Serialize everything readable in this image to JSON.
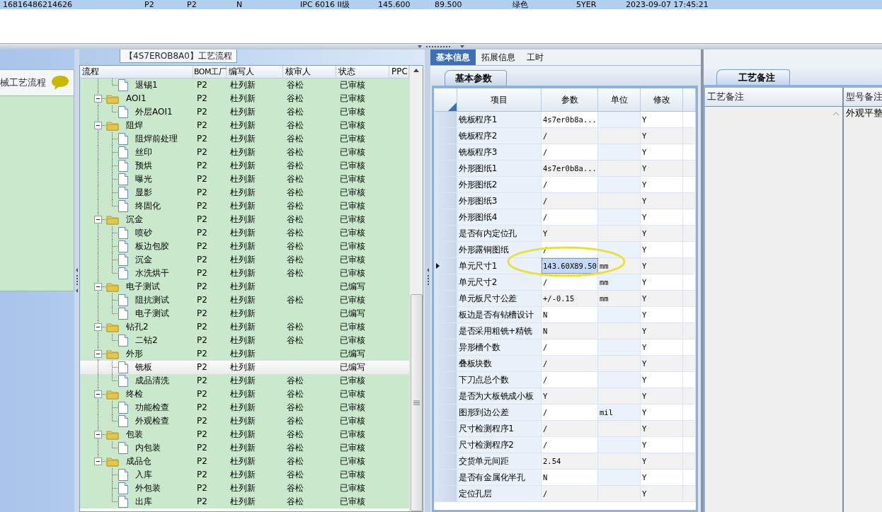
{
  "top_table": {
    "row": [
      "16816486214626",
      "P2",
      "P2",
      "N",
      "IPC 6016 II级",
      "145.600",
      "89.500",
      "绿色",
      "5YER",
      "2023-09-07 17:45:21"
    ]
  },
  "sidebar": {
    "title": "械工艺流程"
  },
  "flow": {
    "title": "【4S7EROB8A0】工艺流程",
    "columns": [
      "流程",
      "BOM工厂",
      "编写人",
      "核审人",
      "状态",
      "PPC"
    ],
    "rows": [
      {
        "kind": "file",
        "label": "退锡1",
        "bom_plant": "P2",
        "writer": "杜列新",
        "reviewer": "谷松",
        "status": "已审核",
        "selected": false
      },
      {
        "kind": "folder",
        "label": "AOI1",
        "bom_plant": "P2",
        "writer": "杜列新",
        "reviewer": "谷松",
        "status": "已审核",
        "selected": false,
        "expanded": true,
        "children": [
          {
            "kind": "file",
            "label": "外层AOI1",
            "bom_plant": "P2",
            "writer": "杜列新",
            "reviewer": "谷松",
            "status": "已审核",
            "selected": false
          }
        ]
      },
      {
        "kind": "folder",
        "label": "阻焊",
        "bom_plant": "P2",
        "writer": "杜列新",
        "reviewer": "谷松",
        "status": "已审核",
        "selected": false,
        "expanded": true,
        "children": [
          {
            "kind": "file",
            "label": "阻焊前处理",
            "bom_plant": "P2",
            "writer": "杜列新",
            "reviewer": "谷松",
            "status": "已审核",
            "selected": false
          },
          {
            "kind": "file",
            "label": "丝印",
            "bom_plant": "P2",
            "writer": "杜列新",
            "reviewer": "谷松",
            "status": "已审核",
            "selected": false
          },
          {
            "kind": "file",
            "label": "预烘",
            "bom_plant": "P2",
            "writer": "杜列新",
            "reviewer": "谷松",
            "status": "已审核",
            "selected": false
          },
          {
            "kind": "file",
            "label": "曝光",
            "bom_plant": "P2",
            "writer": "杜列新",
            "reviewer": "谷松",
            "status": "已审核",
            "selected": false
          },
          {
            "kind": "file",
            "label": "显影",
            "bom_plant": "P2",
            "writer": "杜列新",
            "reviewer": "谷松",
            "status": "已审核",
            "selected": false
          },
          {
            "kind": "file",
            "label": "终固化",
            "bom_plant": "P2",
            "writer": "杜列新",
            "reviewer": "谷松",
            "status": "已审核",
            "selected": false
          }
        ]
      },
      {
        "kind": "folder",
        "label": "沉金",
        "bom_plant": "P2",
        "writer": "杜列新",
        "reviewer": "谷松",
        "status": "已审核",
        "selected": false,
        "expanded": true,
        "children": [
          {
            "kind": "file",
            "label": "喷砂",
            "bom_plant": "P2",
            "writer": "杜列新",
            "reviewer": "谷松",
            "status": "已审核",
            "selected": false
          },
          {
            "kind": "file",
            "label": "板边包胶",
            "bom_plant": "P2",
            "writer": "杜列新",
            "reviewer": "谷松",
            "status": "已审核",
            "selected": false
          },
          {
            "kind": "file",
            "label": "沉金",
            "bom_plant": "P2",
            "writer": "杜列新",
            "reviewer": "谷松",
            "status": "已审核",
            "selected": false
          },
          {
            "kind": "file",
            "label": "水洗烘干",
            "bom_plant": "P2",
            "writer": "杜列新",
            "reviewer": "谷松",
            "status": "已审核",
            "selected": false
          }
        ]
      },
      {
        "kind": "folder",
        "label": "电子测试",
        "bom_plant": "P2",
        "writer": "杜列新",
        "status": "已编写",
        "selected": false,
        "expanded": true,
        "children": [
          {
            "kind": "file",
            "label": "阻抗测试",
            "bom_plant": "P2",
            "writer": "杜列新",
            "reviewer": "谷松",
            "status": "已审核",
            "selected": false
          },
          {
            "kind": "file",
            "label": "电子测试",
            "bom_plant": "P2",
            "writer": "杜列新",
            "status": "已编写",
            "selected": false
          }
        ]
      },
      {
        "kind": "folder",
        "label": "钻孔2",
        "bom_plant": "P2",
        "writer": "杜列新",
        "reviewer": "谷松",
        "status": "已审核",
        "selected": false,
        "expanded": true,
        "children": [
          {
            "kind": "file",
            "label": "二钻2",
            "bom_plant": "P2",
            "writer": "杜列新",
            "reviewer": "谷松",
            "status": "已审核",
            "selected": false
          }
        ]
      },
      {
        "kind": "folder",
        "label": "外形",
        "bom_plant": "P2",
        "writer": "杜列新",
        "status": "已编写",
        "selected": false,
        "expanded": true,
        "children": [
          {
            "kind": "file",
            "label": "铣板",
            "bom_plant": "P2",
            "writer": "杜列新",
            "status": "已编写",
            "selected": true
          },
          {
            "kind": "file",
            "label": "成品清洗",
            "bom_plant": "P2",
            "writer": "杜列新",
            "reviewer": "谷松",
            "status": "已审核",
            "selected": false
          }
        ]
      },
      {
        "kind": "folder",
        "label": "终检",
        "bom_plant": "P2",
        "writer": "杜列新",
        "reviewer": "谷松",
        "status": "已审核",
        "selected": false,
        "expanded": true,
        "children": [
          {
            "kind": "file",
            "label": "功能检查",
            "bom_plant": "P2",
            "writer": "杜列新",
            "reviewer": "谷松",
            "status": "已审核",
            "selected": false
          },
          {
            "kind": "file",
            "label": "外观检查",
            "bom_plant": "P2",
            "writer": "杜列新",
            "reviewer": "谷松",
            "status": "已审核",
            "selected": false
          }
        ]
      },
      {
        "kind": "folder",
        "label": "包装",
        "bom_plant": "P2",
        "writer": "杜列新",
        "reviewer": "谷松",
        "status": "已审核",
        "selected": false,
        "expanded": true,
        "children": [
          {
            "kind": "file",
            "label": "内包装",
            "bom_plant": "P2",
            "writer": "杜列新",
            "reviewer": "谷松",
            "status": "已审核",
            "selected": false
          }
        ]
      },
      {
        "kind": "folder",
        "label": "成品仓",
        "bom_plant": "P2",
        "writer": "杜列新",
        "reviewer": "谷松",
        "status": "已审核",
        "selected": false,
        "expanded": true,
        "children": [
          {
            "kind": "file",
            "label": "入库",
            "bom_plant": "P2",
            "writer": "杜列新",
            "reviewer": "谷松",
            "status": "已审核",
            "selected": false
          },
          {
            "kind": "file",
            "label": "外包装",
            "bom_plant": "P2",
            "writer": "杜列新",
            "reviewer": "谷松",
            "status": "已审核",
            "selected": false
          },
          {
            "kind": "file",
            "label": "出库",
            "bom_plant": "P2",
            "writer": "杜列新",
            "reviewer": "谷松",
            "status": "已审核",
            "selected": false
          }
        ]
      }
    ]
  },
  "info": {
    "tabs": [
      {
        "label": "基本信息",
        "selected": true
      },
      {
        "label": "拓展信息",
        "selected": false
      },
      {
        "label": "工时",
        "selected": false
      }
    ],
    "section_tab": "基本参数",
    "columns": [
      "项目",
      "参数",
      "单位",
      "修改"
    ],
    "rows": [
      {
        "item": "铣板程序1",
        "value": "4s7er0b8a...",
        "modify": "Y",
        "selected": false
      },
      {
        "item": "铣板程序2",
        "value": "/",
        "modify": "Y",
        "selected": false
      },
      {
        "item": "铣板程序3",
        "value": "/",
        "modify": "Y",
        "selected": false
      },
      {
        "item": "外形图纸1",
        "value": "4s7er0b8a...",
        "modify": "Y",
        "selected": false
      },
      {
        "item": "外形图纸2",
        "value": "/",
        "modify": "Y",
        "selected": false
      },
      {
        "item": "外形图纸3",
        "value": "/",
        "modify": "Y",
        "selected": false
      },
      {
        "item": "外形图纸4",
        "value": "/",
        "modify": "Y",
        "selected": false
      },
      {
        "item": "是否有内定位孔",
        "value": "Y",
        "modify": "Y",
        "selected": false
      },
      {
        "item": "外形露铜图纸",
        "value": "/",
        "modify": "Y",
        "selected": false
      },
      {
        "item": "单元尺寸1",
        "value": "143.60X89.50",
        "unit": "mm",
        "modify": "Y",
        "selected": true
      },
      {
        "item": "单元尺寸2",
        "value": "/",
        "unit": "mm",
        "modify": "Y",
        "selected": false
      },
      {
        "item": "单元板尺寸公差",
        "value": "+/-0.15",
        "unit": "mm",
        "modify": "Y",
        "selected": false
      },
      {
        "item": "板边是否有钻槽设计",
        "value": "N",
        "modify": "Y",
        "selected": false
      },
      {
        "item": "是否采用粗铣+精铣",
        "value": "N",
        "modify": "Y",
        "selected": false
      },
      {
        "item": "异形槽个数",
        "value": "/",
        "modify": "Y",
        "selected": false
      },
      {
        "item": "叠板块数",
        "value": "/",
        "modify": "Y",
        "selected": false
      },
      {
        "item": "下刀点总个数",
        "value": "/",
        "modify": "Y",
        "selected": false
      },
      {
        "item": "是否为大板铣成小板",
        "value": "Y",
        "modify": "Y",
        "selected": false
      },
      {
        "item": "图形到边公差",
        "value": "/",
        "unit": "mil",
        "modify": "Y",
        "selected": false
      },
      {
        "item": "尺寸检测程序1",
        "value": "/",
        "modify": "Y",
        "selected": false
      },
      {
        "item": "尺寸检测程序2",
        "value": "/",
        "modify": "Y",
        "selected": false
      },
      {
        "item": "交货单元间距",
        "value": "2.54",
        "modify": "Y",
        "selected": false
      },
      {
        "item": "是否有金属化半孔",
        "value": "N",
        "modify": "Y",
        "selected": false
      },
      {
        "item": "定位孔层",
        "value": "/",
        "modify": "Y",
        "selected": false
      }
    ]
  },
  "notes": {
    "section_tab": "工艺备注",
    "columns": [
      "工艺备注",
      "型号备注"
    ],
    "model_note": "外观平整"
  }
}
